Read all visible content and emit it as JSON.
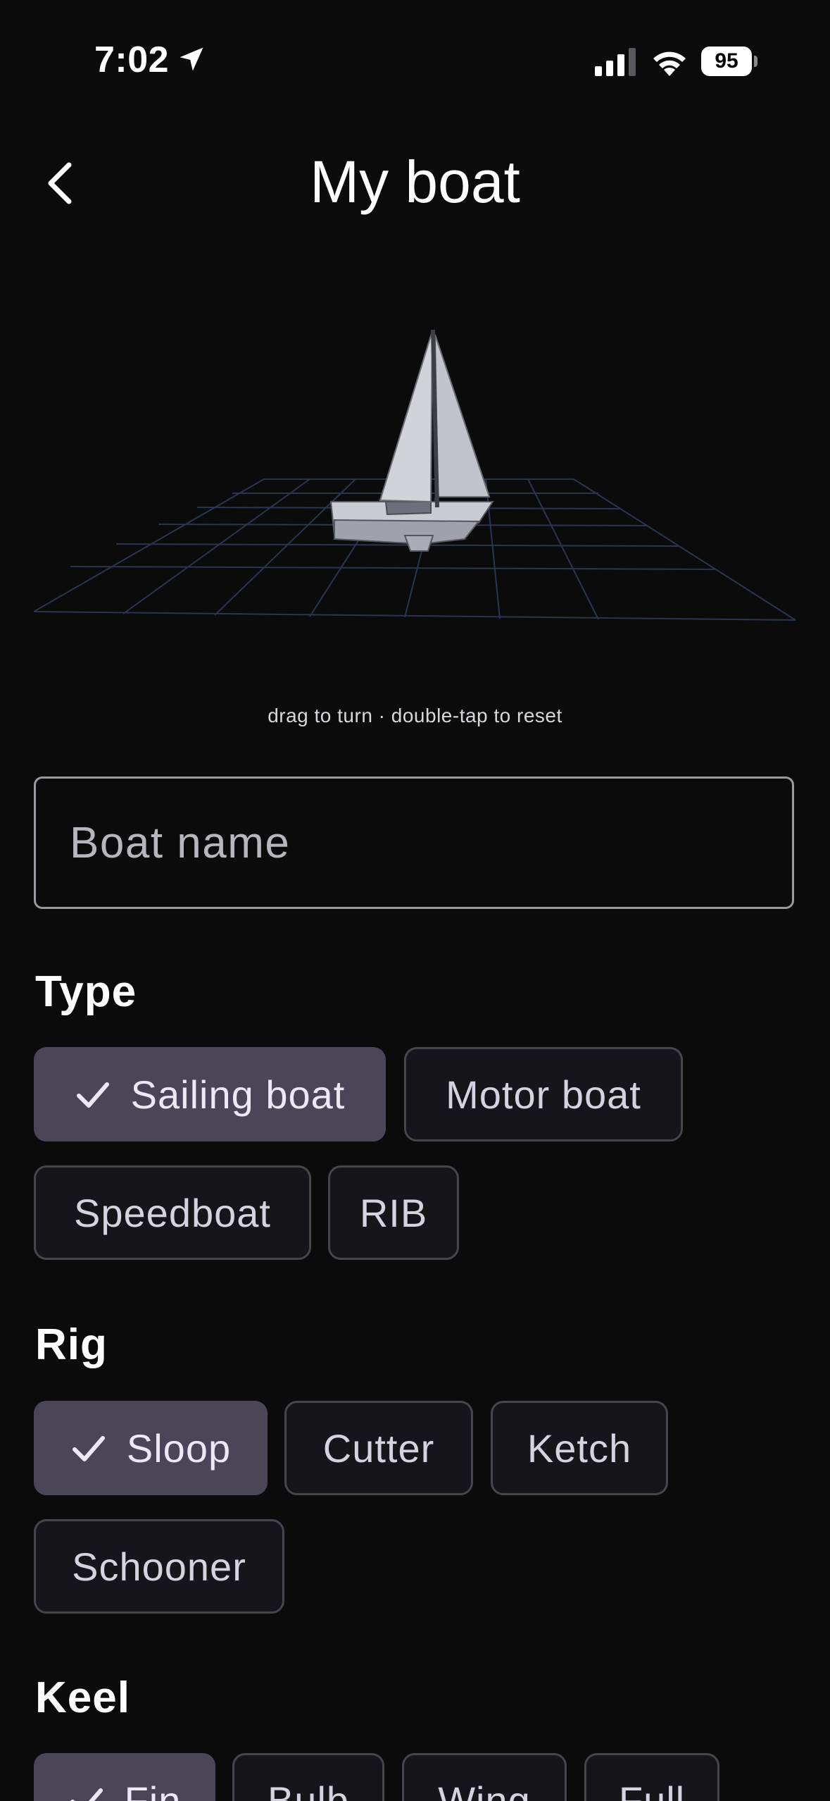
{
  "status_bar": {
    "time": "7:02",
    "battery": "95",
    "icons": [
      "location-arrow-icon",
      "cellular-signal-icon",
      "wifi-icon",
      "battery-icon"
    ]
  },
  "header": {
    "title": "My boat",
    "back_icon": "chevron-left-icon"
  },
  "viewer": {
    "hint": "drag to turn · double-tap to reset",
    "model": "sailboat-3d-model"
  },
  "boat_name": {
    "placeholder": "Boat name",
    "value": ""
  },
  "type": {
    "title": "Type",
    "options": [
      {
        "label": "Sailing boat",
        "selected": true
      },
      {
        "label": "Motor boat",
        "selected": false
      },
      {
        "label": "Speedboat",
        "selected": false
      },
      {
        "label": "RIB",
        "selected": false
      }
    ]
  },
  "rig": {
    "title": "Rig",
    "options": [
      {
        "label": "Sloop",
        "selected": true
      },
      {
        "label": "Cutter",
        "selected": false
      },
      {
        "label": "Ketch",
        "selected": false
      },
      {
        "label": "Schooner",
        "selected": false
      }
    ]
  },
  "keel": {
    "title": "Keel",
    "options": [
      {
        "label": "Fin",
        "selected": true
      },
      {
        "label": "Bulb",
        "selected": false
      },
      {
        "label": "Wing",
        "selected": false
      },
      {
        "label": "Full",
        "selected": false
      }
    ]
  },
  "colors": {
    "background": "#0b0b0c",
    "chip_selected": "#4a4658",
    "chip_border": "#46454e",
    "grid": "#2a3550"
  }
}
